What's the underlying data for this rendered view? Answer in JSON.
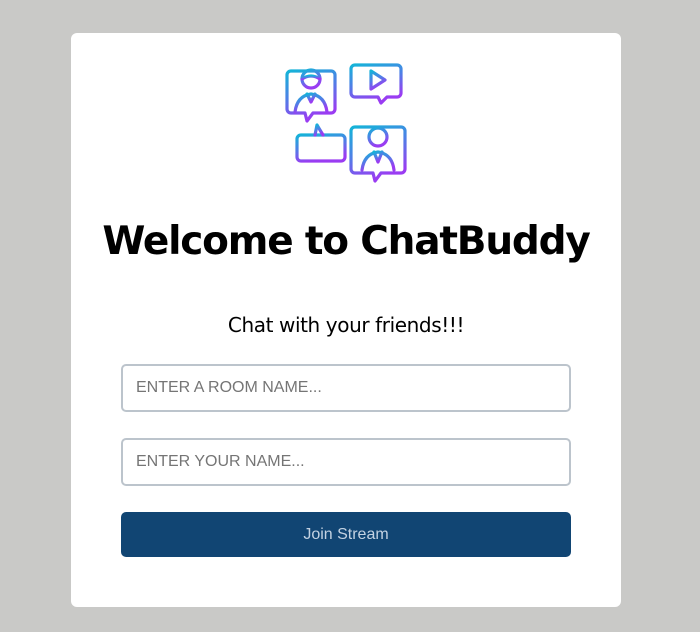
{
  "page": {
    "title": "Welcome to ChatBuddy",
    "subtitle": "Chat with your friends!!!"
  },
  "logo": {
    "icon": "chat-people-icon",
    "colors": {
      "teal": "#1fa6d9",
      "purple": "#8b46f0"
    }
  },
  "form": {
    "room_placeholder": "ENTER A ROOM NAME...",
    "name_placeholder": "ENTER YOUR NAME...",
    "submit_label": "Join Stream"
  },
  "colors": {
    "background": "#c9c9c7",
    "card": "#ffffff",
    "button": "#114573",
    "button_text": "#c3d2e2",
    "input_border": "#bcc4cc"
  }
}
